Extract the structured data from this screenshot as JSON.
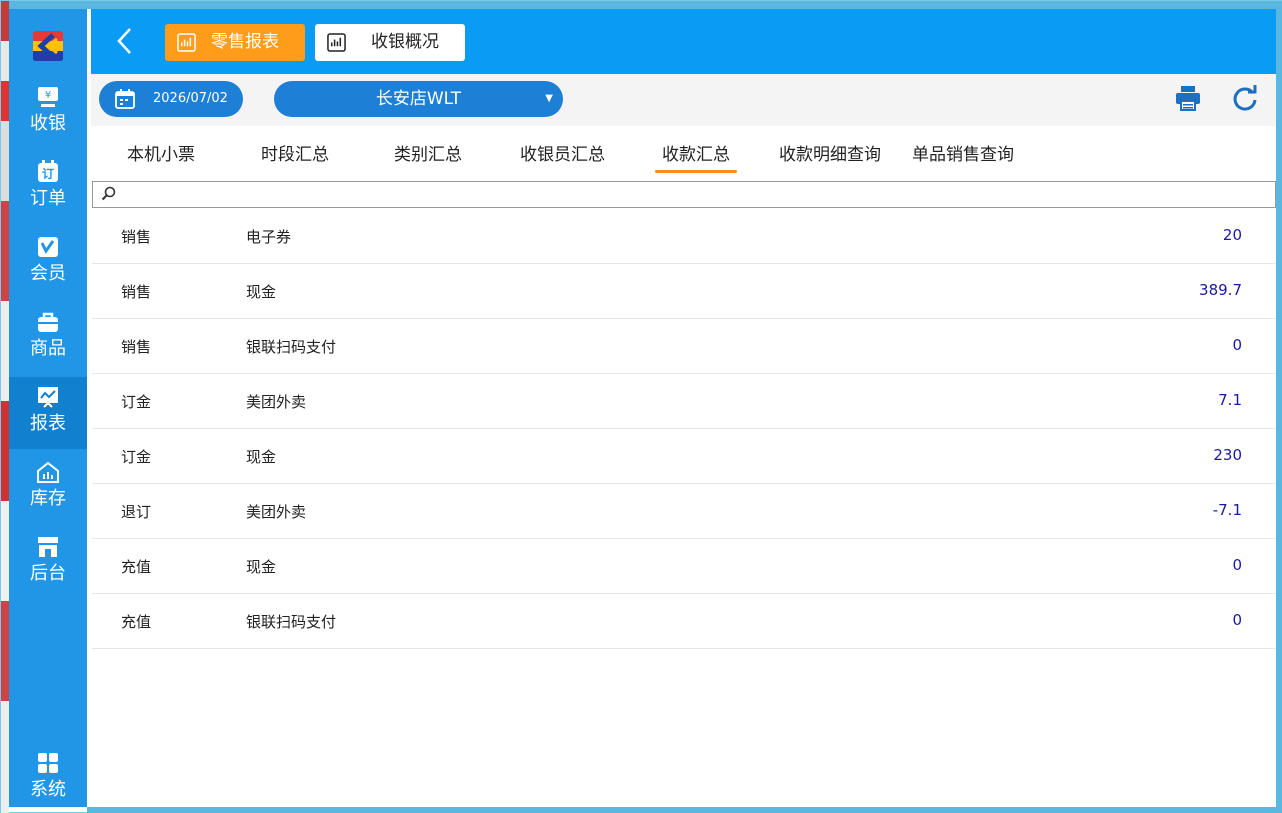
{
  "sidebar": {
    "items": [
      {
        "label": "收银",
        "icon": "cashier-icon"
      },
      {
        "label": "订单",
        "icon": "order-icon"
      },
      {
        "label": "会员",
        "icon": "member-icon"
      },
      {
        "label": "商品",
        "icon": "goods-icon"
      },
      {
        "label": "报表",
        "icon": "report-icon"
      },
      {
        "label": "库存",
        "icon": "inventory-icon"
      },
      {
        "label": "后台",
        "icon": "backend-icon"
      }
    ],
    "bottom": {
      "label": "系统",
      "icon": "grid-icon"
    }
  },
  "header": {
    "tabs": [
      {
        "label": "零售报表"
      },
      {
        "label": "收银概况"
      }
    ]
  },
  "filter": {
    "date": "2026/07/02",
    "store": "长安店WLT"
  },
  "subtabs": [
    {
      "label": "本机小票"
    },
    {
      "label": "时段汇总"
    },
    {
      "label": "类别汇总"
    },
    {
      "label": "收银员汇总"
    },
    {
      "label": "收款汇总"
    },
    {
      "label": "收款明细查询"
    },
    {
      "label": "单品销售查询"
    }
  ],
  "search": {
    "value": "",
    "placeholder": ""
  },
  "rows": [
    {
      "type": "销售",
      "method": "电子券",
      "amount": "20"
    },
    {
      "type": "销售",
      "method": "现金",
      "amount": "389.7"
    },
    {
      "type": "销售",
      "method": "银联扫码支付",
      "amount": "0"
    },
    {
      "type": "订金",
      "method": "美团外卖",
      "amount": "7.1"
    },
    {
      "type": "订金",
      "method": "现金",
      "amount": "230"
    },
    {
      "type": "退订",
      "method": "美团外卖",
      "amount": "-7.1"
    },
    {
      "type": "充值",
      "method": "现金",
      "amount": "0"
    },
    {
      "type": "充值",
      "method": "银联扫码支付",
      "amount": "0"
    }
  ],
  "colors": {
    "sidebar": "#2196e6",
    "sidebar_active": "#1180cf",
    "topbar": "#0a9cf5",
    "accent_orange": "#ff9c1a",
    "pill_blue": "#1d7fd6",
    "amount_text": "#1a1aa0"
  }
}
